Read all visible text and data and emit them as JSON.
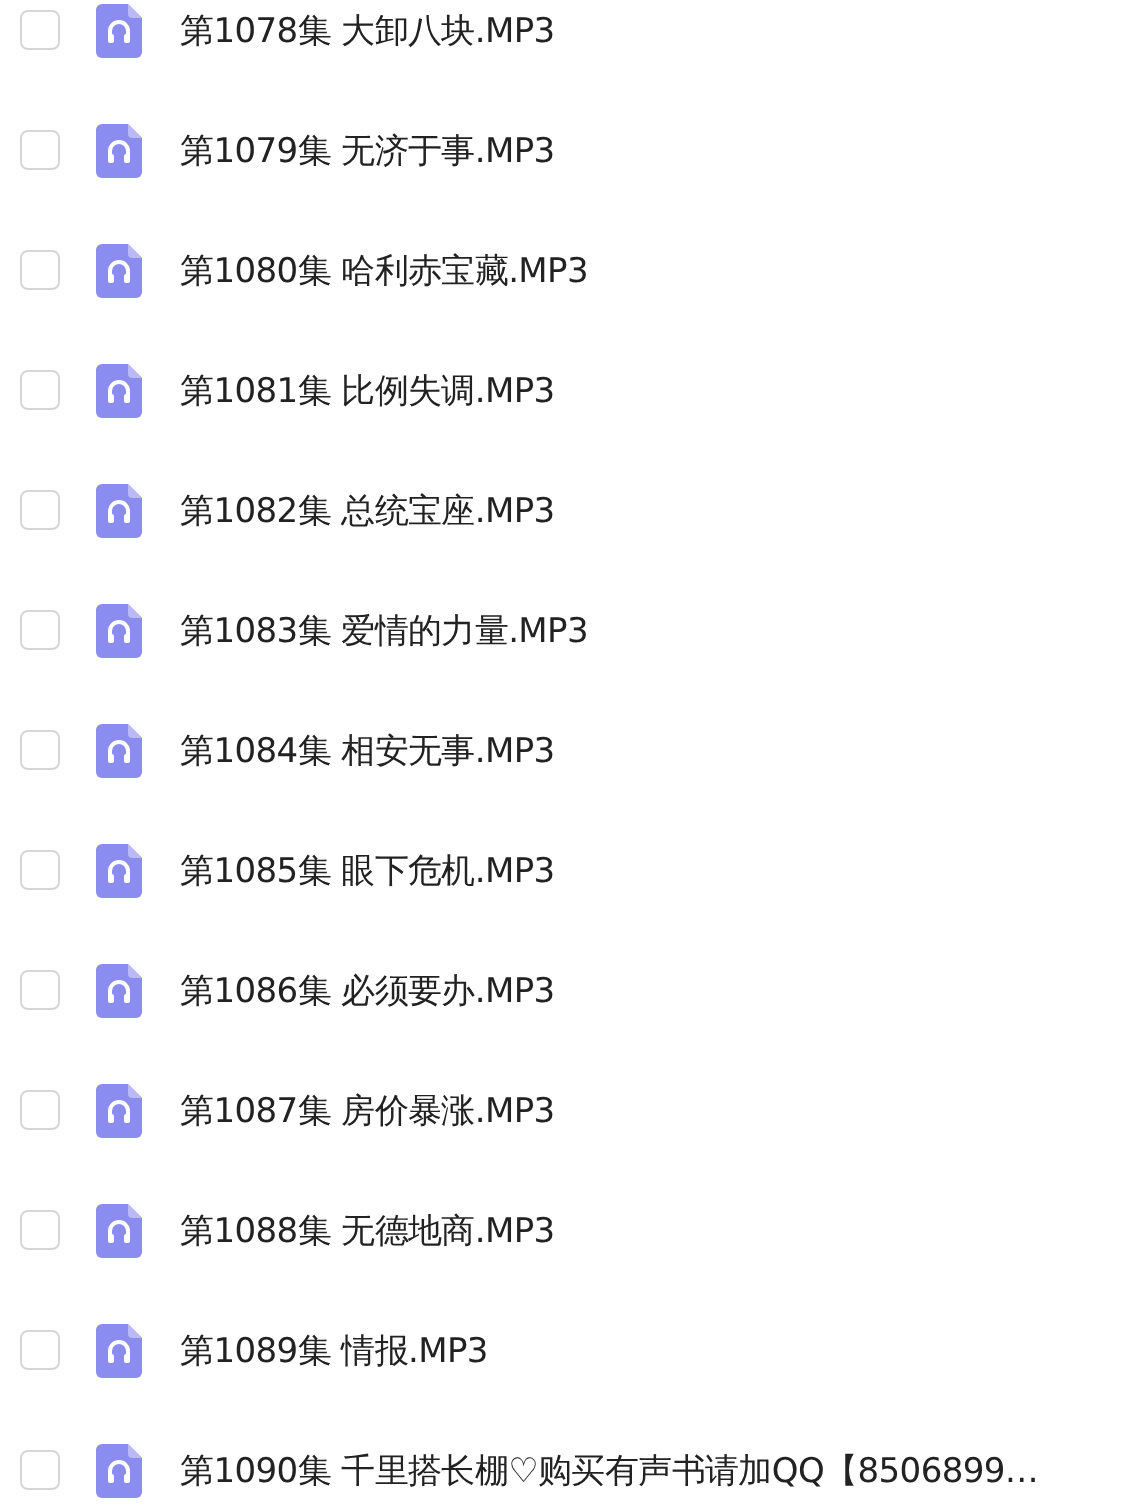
{
  "files": [
    {
      "name": "第1078集 大卸八块.MP3",
      "checked": false
    },
    {
      "name": "第1079集 无济于事.MP3",
      "checked": false
    },
    {
      "name": "第1080集 哈利赤宝藏.MP3",
      "checked": false
    },
    {
      "name": "第1081集 比例失调.MP3",
      "checked": false
    },
    {
      "name": "第1082集 总统宝座.MP3",
      "checked": false
    },
    {
      "name": "第1083集 爱情的力量.MP3",
      "checked": false
    },
    {
      "name": "第1084集 相安无事.MP3",
      "checked": false
    },
    {
      "name": "第1085集 眼下危机.MP3",
      "checked": false
    },
    {
      "name": "第1086集 必须要办.MP3",
      "checked": false
    },
    {
      "name": "第1087集 房价暴涨.MP3",
      "checked": false
    },
    {
      "name": "第1088集 无德地商.MP3",
      "checked": false
    },
    {
      "name": "第1089集 情报.MP3",
      "checked": false
    },
    {
      "name": "第1090集 千里搭长棚♡购买有声书请加QQ【8506899…",
      "checked": false
    }
  ]
}
